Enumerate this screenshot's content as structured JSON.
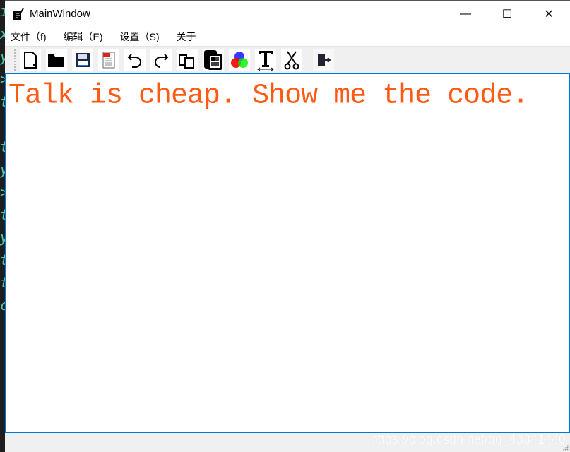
{
  "window": {
    "title": "MainWindow",
    "minimize": "—",
    "maximize": "☐",
    "close": "✕"
  },
  "menu": [
    "文件（f)",
    "编辑（E)",
    "设置（S)",
    "关于"
  ],
  "toolbar": [
    {
      "name": "new-file",
      "glyph": "🗋"
    },
    {
      "name": "open-folder",
      "glyph": "📂"
    },
    {
      "name": "save",
      "glyph": "💾"
    },
    {
      "name": "export-pdf",
      "glyph": "PDF"
    },
    {
      "name": "undo",
      "glyph": "↶"
    },
    {
      "name": "redo",
      "glyph": "↷"
    },
    {
      "name": "copy",
      "glyph": "⧉"
    },
    {
      "name": "paste",
      "glyph": "📰"
    },
    {
      "name": "color",
      "glyph": "●"
    },
    {
      "name": "font",
      "glyph": "T"
    },
    {
      "name": "cut",
      "glyph": "✂"
    },
    {
      "name": "exit",
      "glyph": "⇥"
    }
  ],
  "editor": {
    "text": "Talk is cheap. Show me the code.",
    "color": "#ff5a14"
  },
  "status": {
    "watermark": "https://blog.csdn.net/qq_43341440"
  }
}
